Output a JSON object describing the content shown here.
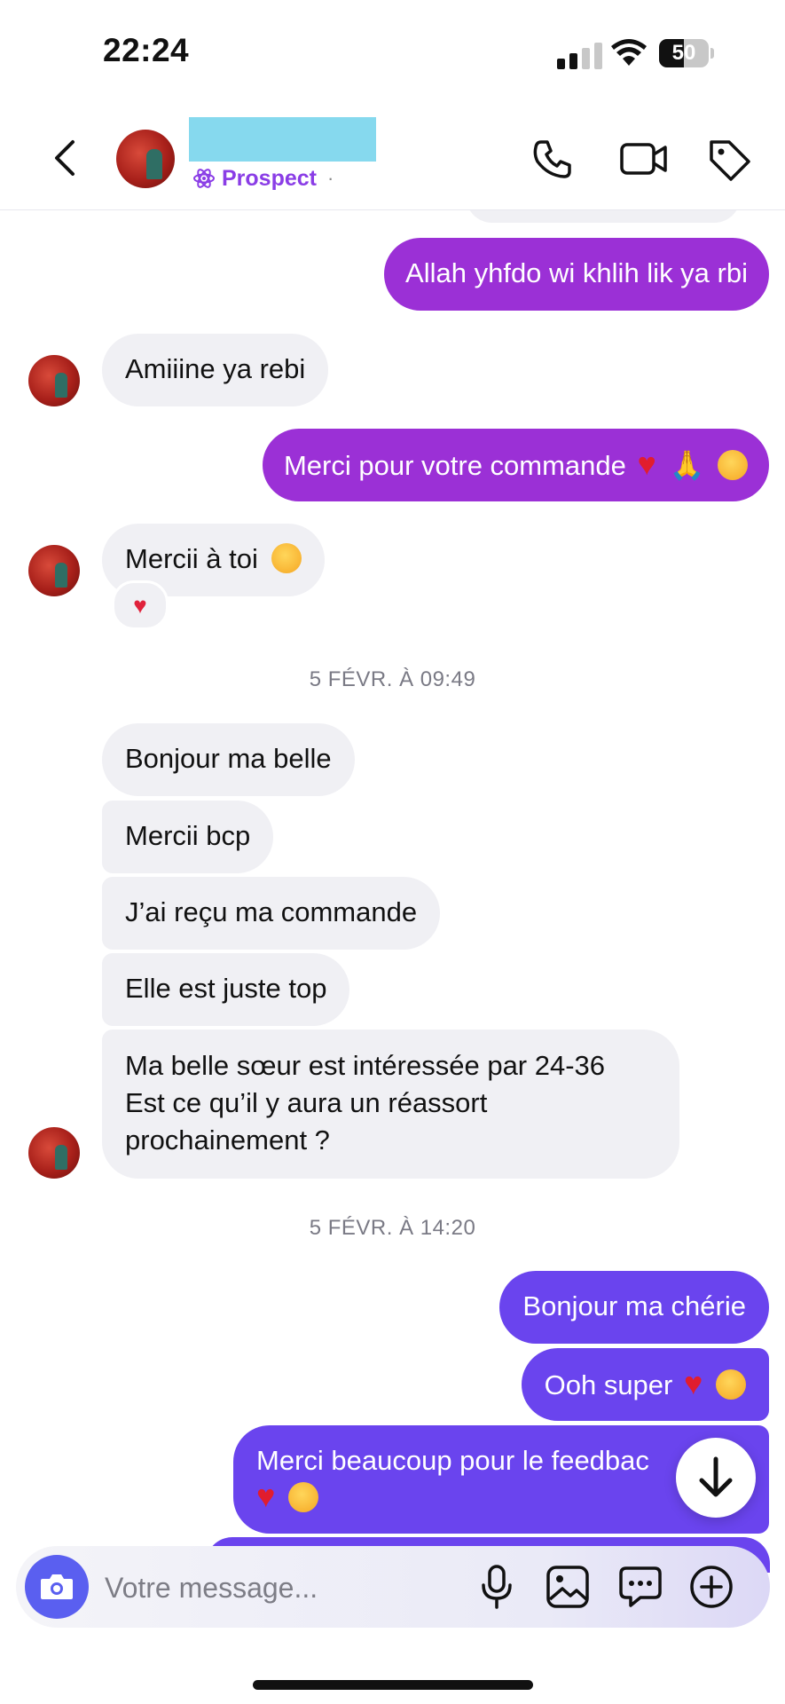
{
  "status_bar": {
    "time": "22:24",
    "battery": "50",
    "battery_level": 0.5
  },
  "header": {
    "label": "Prospect",
    "separator": "·"
  },
  "messages": [
    {
      "side": "out",
      "text": "Allah yhfdo wi khlih lik ya rbi"
    },
    {
      "side": "in",
      "text": "Amiiine ya rebi"
    },
    {
      "side": "out",
      "text": "Merci pour votre commande",
      "emoji": [
        "red-heart",
        "folded-hands",
        "face-blowing-kiss"
      ]
    },
    {
      "side": "in",
      "text": "Mercii à toi",
      "emoji": [
        "smiling-face-with-hearts"
      ],
      "reaction": "red-heart"
    },
    {
      "side": "in",
      "text": "Bonjour ma belle"
    },
    {
      "side": "in",
      "text": "Mercii bcp"
    },
    {
      "side": "in",
      "text": "J’ai reçu ma commande"
    },
    {
      "side": "in",
      "text": "Elle est juste top"
    },
    {
      "side": "in",
      "lines": [
        "Ma belle sœur est intéressée par 24-36",
        "Est ce qu’il y aura un réassort",
        "prochainement ?"
      ]
    },
    {
      "side": "out",
      "text": "Bonjour ma chérie"
    },
    {
      "side": "out",
      "text": "Ooh super",
      "emoji": [
        "red-heart",
        "smiling-face-with-hearts"
      ]
    },
    {
      "side": "out",
      "text": "Merci beaucoup pour le feedbac",
      "emoji": [
        "red-heart",
        "face-blowing-kiss"
      ]
    }
  ],
  "timestamps": [
    "5 FÉVR. À 09:49",
    "5 FÉVR. À 14:20"
  ],
  "composer": {
    "placeholder": "Votre message..."
  },
  "colors": {
    "purple_bubble": "#9b30d6",
    "violet_bubble": "#6a44ee",
    "incoming_bubble": "#f0f0f4",
    "accent": "#8a3de6"
  },
  "icons": [
    "back-icon",
    "phone-icon",
    "video-icon",
    "tag-icon",
    "camera-icon",
    "microphone-icon",
    "image-icon",
    "chat-icon",
    "plus-icon",
    "arrow-down-icon"
  ]
}
